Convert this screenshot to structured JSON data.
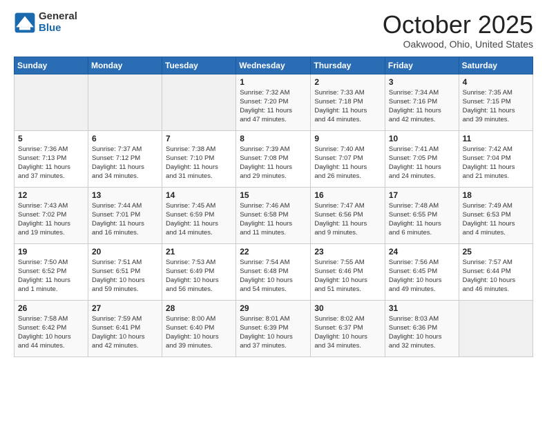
{
  "logo": {
    "general": "General",
    "blue": "Blue"
  },
  "title": {
    "month": "October 2025",
    "location": "Oakwood, Ohio, United States"
  },
  "weekdays": [
    "Sunday",
    "Monday",
    "Tuesday",
    "Wednesday",
    "Thursday",
    "Friday",
    "Saturday"
  ],
  "weeks": [
    [
      {
        "day": "",
        "info": ""
      },
      {
        "day": "",
        "info": ""
      },
      {
        "day": "",
        "info": ""
      },
      {
        "day": "1",
        "info": "Sunrise: 7:32 AM\nSunset: 7:20 PM\nDaylight: 11 hours\nand 47 minutes."
      },
      {
        "day": "2",
        "info": "Sunrise: 7:33 AM\nSunset: 7:18 PM\nDaylight: 11 hours\nand 44 minutes."
      },
      {
        "day": "3",
        "info": "Sunrise: 7:34 AM\nSunset: 7:16 PM\nDaylight: 11 hours\nand 42 minutes."
      },
      {
        "day": "4",
        "info": "Sunrise: 7:35 AM\nSunset: 7:15 PM\nDaylight: 11 hours\nand 39 minutes."
      }
    ],
    [
      {
        "day": "5",
        "info": "Sunrise: 7:36 AM\nSunset: 7:13 PM\nDaylight: 11 hours\nand 37 minutes."
      },
      {
        "day": "6",
        "info": "Sunrise: 7:37 AM\nSunset: 7:12 PM\nDaylight: 11 hours\nand 34 minutes."
      },
      {
        "day": "7",
        "info": "Sunrise: 7:38 AM\nSunset: 7:10 PM\nDaylight: 11 hours\nand 31 minutes."
      },
      {
        "day": "8",
        "info": "Sunrise: 7:39 AM\nSunset: 7:08 PM\nDaylight: 11 hours\nand 29 minutes."
      },
      {
        "day": "9",
        "info": "Sunrise: 7:40 AM\nSunset: 7:07 PM\nDaylight: 11 hours\nand 26 minutes."
      },
      {
        "day": "10",
        "info": "Sunrise: 7:41 AM\nSunset: 7:05 PM\nDaylight: 11 hours\nand 24 minutes."
      },
      {
        "day": "11",
        "info": "Sunrise: 7:42 AM\nSunset: 7:04 PM\nDaylight: 11 hours\nand 21 minutes."
      }
    ],
    [
      {
        "day": "12",
        "info": "Sunrise: 7:43 AM\nSunset: 7:02 PM\nDaylight: 11 hours\nand 19 minutes."
      },
      {
        "day": "13",
        "info": "Sunrise: 7:44 AM\nSunset: 7:01 PM\nDaylight: 11 hours\nand 16 minutes."
      },
      {
        "day": "14",
        "info": "Sunrise: 7:45 AM\nSunset: 6:59 PM\nDaylight: 11 hours\nand 14 minutes."
      },
      {
        "day": "15",
        "info": "Sunrise: 7:46 AM\nSunset: 6:58 PM\nDaylight: 11 hours\nand 11 minutes."
      },
      {
        "day": "16",
        "info": "Sunrise: 7:47 AM\nSunset: 6:56 PM\nDaylight: 11 hours\nand 9 minutes."
      },
      {
        "day": "17",
        "info": "Sunrise: 7:48 AM\nSunset: 6:55 PM\nDaylight: 11 hours\nand 6 minutes."
      },
      {
        "day": "18",
        "info": "Sunrise: 7:49 AM\nSunset: 6:53 PM\nDaylight: 11 hours\nand 4 minutes."
      }
    ],
    [
      {
        "day": "19",
        "info": "Sunrise: 7:50 AM\nSunset: 6:52 PM\nDaylight: 11 hours\nand 1 minute."
      },
      {
        "day": "20",
        "info": "Sunrise: 7:51 AM\nSunset: 6:51 PM\nDaylight: 10 hours\nand 59 minutes."
      },
      {
        "day": "21",
        "info": "Sunrise: 7:53 AM\nSunset: 6:49 PM\nDaylight: 10 hours\nand 56 minutes."
      },
      {
        "day": "22",
        "info": "Sunrise: 7:54 AM\nSunset: 6:48 PM\nDaylight: 10 hours\nand 54 minutes."
      },
      {
        "day": "23",
        "info": "Sunrise: 7:55 AM\nSunset: 6:46 PM\nDaylight: 10 hours\nand 51 minutes."
      },
      {
        "day": "24",
        "info": "Sunrise: 7:56 AM\nSunset: 6:45 PM\nDaylight: 10 hours\nand 49 minutes."
      },
      {
        "day": "25",
        "info": "Sunrise: 7:57 AM\nSunset: 6:44 PM\nDaylight: 10 hours\nand 46 minutes."
      }
    ],
    [
      {
        "day": "26",
        "info": "Sunrise: 7:58 AM\nSunset: 6:42 PM\nDaylight: 10 hours\nand 44 minutes."
      },
      {
        "day": "27",
        "info": "Sunrise: 7:59 AM\nSunset: 6:41 PM\nDaylight: 10 hours\nand 42 minutes."
      },
      {
        "day": "28",
        "info": "Sunrise: 8:00 AM\nSunset: 6:40 PM\nDaylight: 10 hours\nand 39 minutes."
      },
      {
        "day": "29",
        "info": "Sunrise: 8:01 AM\nSunset: 6:39 PM\nDaylight: 10 hours\nand 37 minutes."
      },
      {
        "day": "30",
        "info": "Sunrise: 8:02 AM\nSunset: 6:37 PM\nDaylight: 10 hours\nand 34 minutes."
      },
      {
        "day": "31",
        "info": "Sunrise: 8:03 AM\nSunset: 6:36 PM\nDaylight: 10 hours\nand 32 minutes."
      },
      {
        "day": "",
        "info": ""
      }
    ]
  ]
}
